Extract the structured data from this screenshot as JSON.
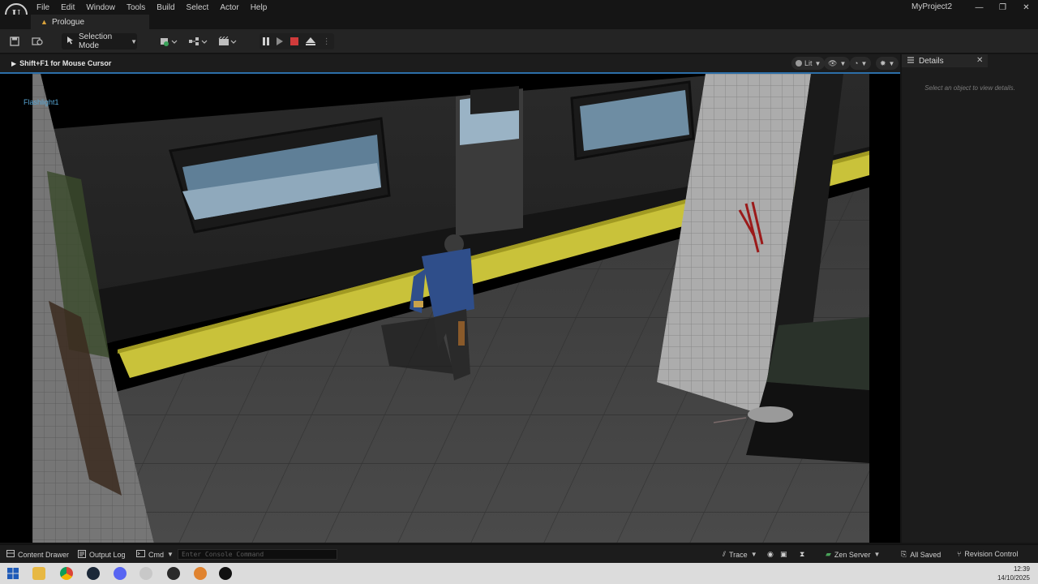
{
  "menu": {
    "logo": "U",
    "items": [
      "File",
      "Edit",
      "Window",
      "Tools",
      "Build",
      "Select",
      "Actor",
      "Help"
    ]
  },
  "window": {
    "project_name": "MyProject2",
    "minimize": "—",
    "restore": "❐",
    "close": "✕"
  },
  "level_tab": {
    "name": "Prologue"
  },
  "toolbar": {
    "mode_label": "Selection Mode"
  },
  "viewport": {
    "hint": "Shift+F1 for Mouse Cursor",
    "lit_label": "Lit",
    "actor_label": "Flashlight1"
  },
  "details": {
    "title": "Details",
    "empty_text": "Select an object to view details."
  },
  "statusbar": {
    "content_drawer": "Content Drawer",
    "output_log": "Output Log",
    "cmd": "Cmd",
    "console_placeholder": "Enter Console Command",
    "trace": "Trace",
    "zen_server": "Zen Server",
    "all_saved": "All Saved",
    "revision_control": "Revision Control"
  },
  "taskbar": {
    "time": "12:39",
    "date": "14/10/2025"
  },
  "colors": {
    "accent_blue": "#2c6ea8",
    "stop_red": "#d03b3b",
    "platform_yellow": "#c9c23a",
    "actor_label": "#58a7d6"
  }
}
